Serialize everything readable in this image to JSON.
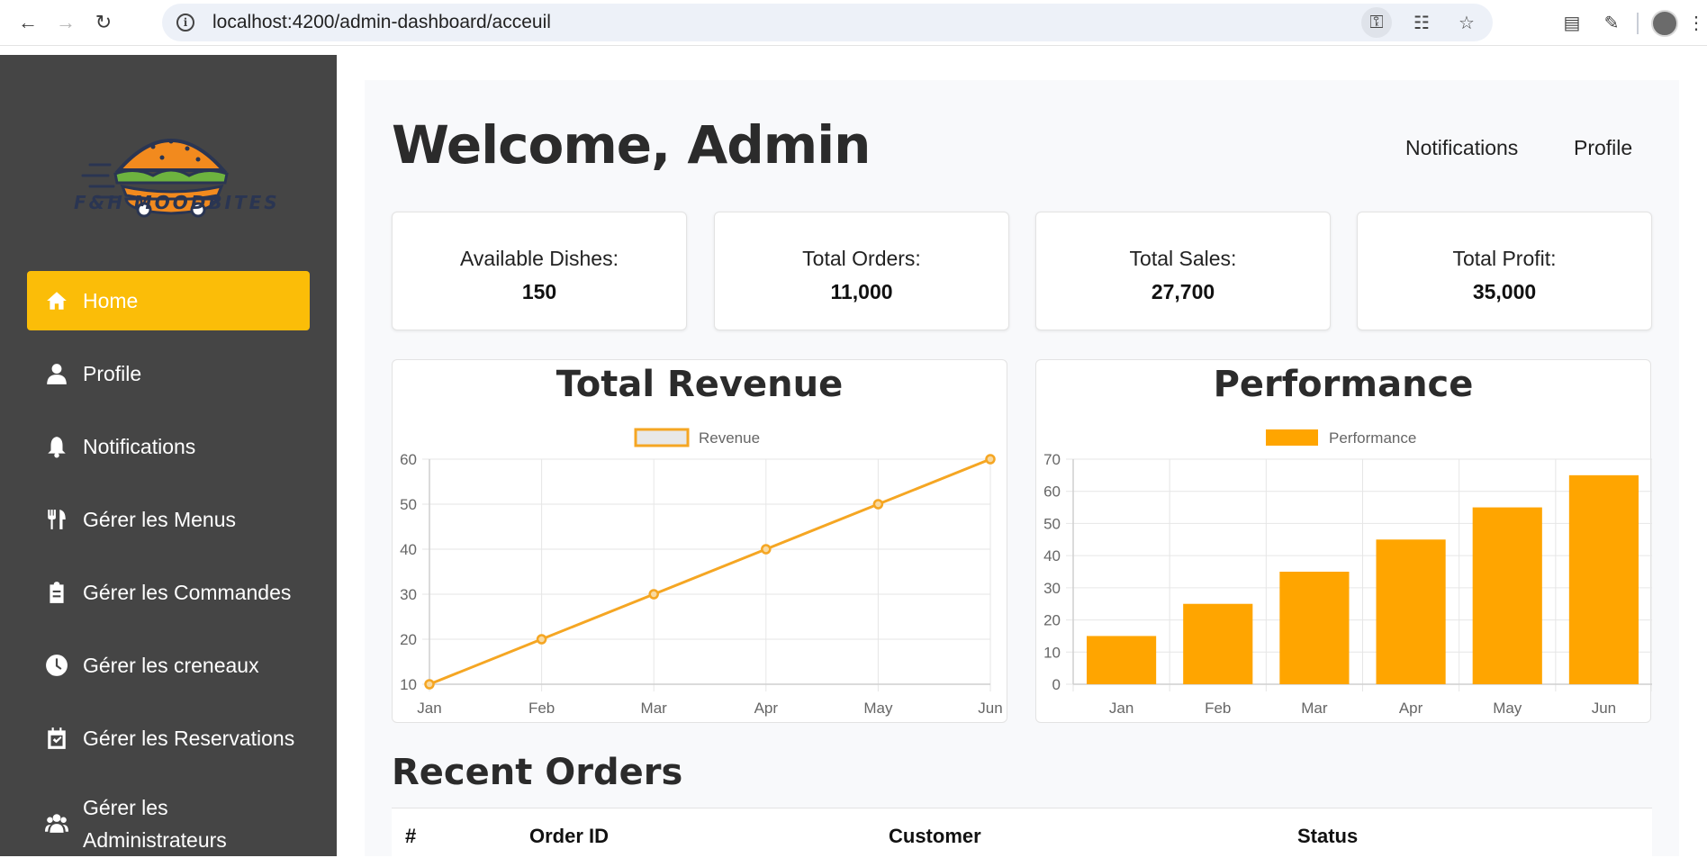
{
  "browser": {
    "url": "localhost:4200/admin-dashboard/acceuil",
    "icons": [
      "back-arrow-icon",
      "forward-arrow-icon",
      "reload-icon",
      "info-icon",
      "key-icon",
      "translate-icon",
      "star-icon",
      "reading-list-icon",
      "extensions-icon",
      "profile-avatar"
    ]
  },
  "sidebar": {
    "logo_text": "F&H MOODBITES",
    "items": [
      {
        "label": "Home",
        "icon": "home-icon",
        "active": true
      },
      {
        "label": "Profile",
        "icon": "user-icon"
      },
      {
        "label": "Notifications",
        "icon": "bell-icon"
      },
      {
        "label": "Gérer les Menus",
        "icon": "utensils-icon"
      },
      {
        "label": "Gérer les Commandes",
        "icon": "clipboard-icon"
      },
      {
        "label": "Gérer les creneaux",
        "icon": "clock-icon"
      },
      {
        "label": "Gérer les Reservations",
        "icon": "calendar-check-icon"
      },
      {
        "label_line1": "Gérer les",
        "label_line2": "Administrateurs",
        "icon": "users-icon"
      }
    ],
    "colors": {
      "background": "#454545",
      "active": "#fbbd08"
    }
  },
  "header": {
    "welcome": "Welcome, Admin",
    "links": {
      "notifications": "Notifications",
      "profile": "Profile"
    }
  },
  "stats": [
    {
      "label": "Available Dishes:",
      "value": "150"
    },
    {
      "label": "Total Orders:",
      "value": "11,000"
    },
    {
      "label": "Total Sales:",
      "value": "27,700"
    },
    {
      "label": "Total Profit:",
      "value": "35,000"
    }
  ],
  "chart_data": [
    {
      "type": "line",
      "title": "Total Revenue",
      "legend": "Revenue",
      "legend_placement": "top-center",
      "categories": [
        "Jan",
        "Feb",
        "Mar",
        "Apr",
        "May",
        "Jun"
      ],
      "series": [
        {
          "name": "Revenue",
          "values": [
            10,
            20,
            30,
            40,
            50,
            60
          ],
          "color": "#f5a623"
        }
      ],
      "ylim": [
        10,
        60
      ],
      "yticks": [
        10,
        20,
        30,
        40,
        50,
        60
      ],
      "grid": true
    },
    {
      "type": "bar",
      "title": "Performance",
      "legend": "Performance",
      "legend_placement": "top-center",
      "categories": [
        "Jan",
        "Feb",
        "Mar",
        "Apr",
        "May",
        "Jun"
      ],
      "series": [
        {
          "name": "Performance",
          "values": [
            15,
            25,
            35,
            45,
            55,
            65
          ],
          "color": "#ffa500"
        }
      ],
      "ylim": [
        0,
        70
      ],
      "yticks": [
        0,
        10,
        20,
        30,
        40,
        50,
        60,
        70
      ],
      "grid": true
    }
  ],
  "recent_orders": {
    "title": "Recent Orders",
    "columns": [
      "#",
      "Order ID",
      "Customer",
      "Status"
    ]
  }
}
